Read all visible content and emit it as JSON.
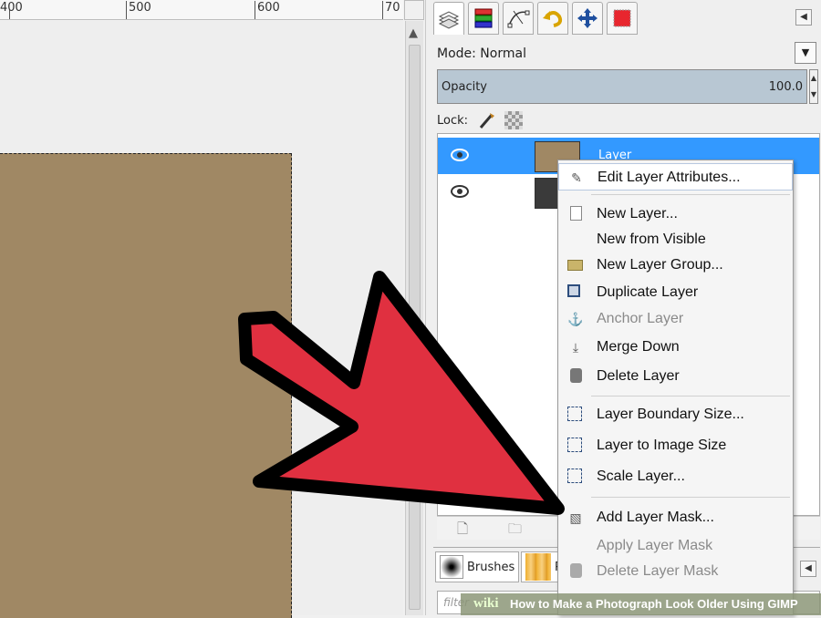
{
  "ruler": {
    "labels": [
      "400",
      "500",
      "600",
      "70"
    ]
  },
  "dock": {
    "tabs": [
      "layers-icon",
      "channels-icon",
      "paths-icon",
      "undo-icon",
      "move-icon",
      "colors-icon"
    ],
    "mode_label": "Mode: Normal",
    "opacity_label": "Opacity",
    "opacity_value": "100.0",
    "lock_label": "Lock:"
  },
  "layers": [
    {
      "name": "Layer",
      "selected": true,
      "thumb_color": "#a08864"
    },
    {
      "name": "",
      "selected": false,
      "thumb_color": "#3a3a3a"
    }
  ],
  "context_menu": {
    "items": [
      {
        "label": "Edit Layer Attributes...",
        "icon": "edit-attributes-icon",
        "disabled": false,
        "highlight": true
      },
      {
        "label": "New Layer...",
        "icon": "new-layer-icon",
        "disabled": false
      },
      {
        "label": "New from Visible",
        "icon": "",
        "disabled": false
      },
      {
        "label": "New Layer Group...",
        "icon": "folder-icon",
        "disabled": false
      },
      {
        "label": "Duplicate Layer",
        "icon": "duplicate-icon",
        "disabled": false
      },
      {
        "label": "Anchor Layer",
        "icon": "anchor-icon",
        "disabled": true
      },
      {
        "label": "Merge Down",
        "icon": "merge-down-icon",
        "disabled": false
      },
      {
        "label": "Delete Layer",
        "icon": "trash-icon",
        "disabled": false
      },
      {
        "label": "Layer Boundary Size...",
        "icon": "boundary-size-icon",
        "disabled": false
      },
      {
        "label": "Layer to Image Size",
        "icon": "image-size-icon",
        "disabled": false
      },
      {
        "label": "Scale Layer...",
        "icon": "scale-icon",
        "disabled": false
      },
      {
        "label": "Add Layer Mask...",
        "icon": "add-mask-icon",
        "disabled": false
      },
      {
        "label": "Apply Layer Mask",
        "icon": "",
        "disabled": true
      },
      {
        "label": "Delete Layer Mask",
        "icon": "trash-icon",
        "disabled": true
      }
    ]
  },
  "bottom_panel": {
    "brushes_label": "Brushes",
    "patterns_label": "P",
    "filter_placeholder": "filter"
  },
  "banner": {
    "wiki": "wiki",
    "caption": "How to Make a Photograph Look Older Using GIMP"
  },
  "colors": {
    "image_fill": "#a08864",
    "selection": "#3399ff",
    "arrow": "#e03040"
  }
}
